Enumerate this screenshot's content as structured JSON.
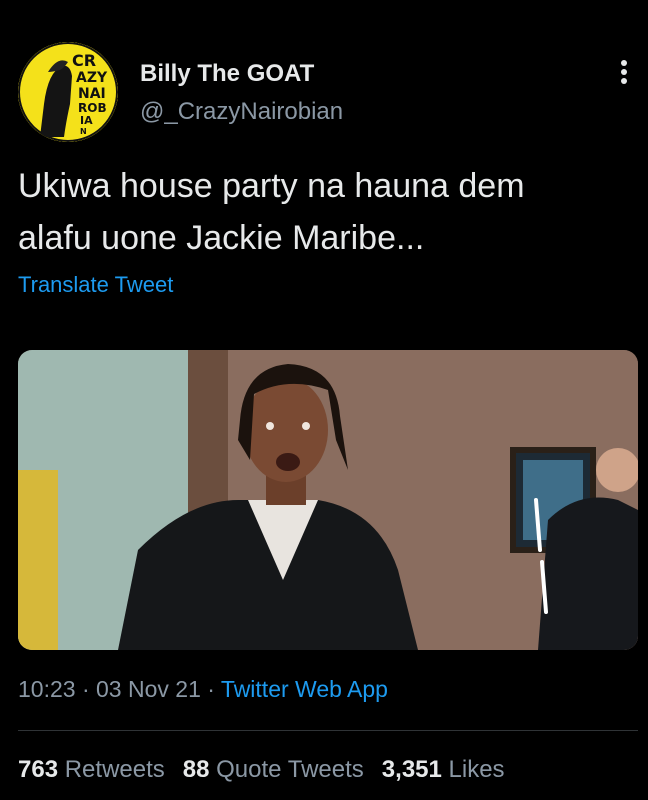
{
  "tweet": {
    "author_name": "Billy The GOAT",
    "author_handle": "@_CrazyNairobian",
    "avatar_text": "CR AZY NAI ROB IA N",
    "text": "Ukiwa house party na hauna dem\nalafu uone Jackie Maribe...",
    "translate_label": "Translate Tweet",
    "time": "10:23",
    "separator": "·",
    "date": "03 Nov 21",
    "source_app": "Twitter Web App"
  },
  "stats": {
    "retweets_count": "763",
    "retweets_label": "Retweets",
    "quotes_count": "88",
    "quotes_label": "Quote Tweets",
    "likes_count": "3,351",
    "likes_label": "Likes"
  },
  "icons": {
    "more": "more-vertical-icon"
  },
  "colors": {
    "background": "#000000",
    "text_primary": "#e7e9ea",
    "text_secondary": "#8b98a5",
    "link": "#1d9bf0",
    "avatar_bg": "#f4e11a"
  }
}
